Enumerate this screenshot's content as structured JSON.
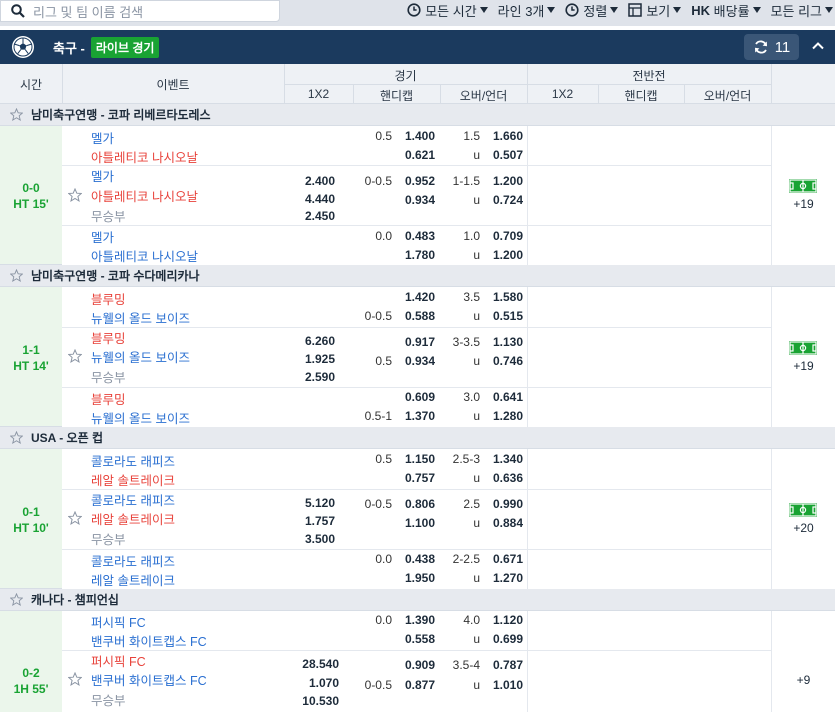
{
  "toolbar": {
    "search_placeholder": "리그 및 팀 이름 검색",
    "time_filter": "모든 시간",
    "lines": "라인 3개",
    "sort": "정렬",
    "view": "보기",
    "odds_type_bold": "HK",
    "odds_type": "배당률",
    "league_filter": "모든 리그"
  },
  "sport": {
    "name": "축구 -",
    "live_label": "라이브 경기",
    "refresh_count": "11"
  },
  "columns": {
    "time": "시간",
    "event": "이벤트",
    "fulltime_group": "경기",
    "halftime_group": "전반전",
    "ft_1x2": "1X2",
    "ft_hdp": "핸디캡",
    "ft_ou": "오버/언더",
    "ht_1x2": "1X2",
    "ht_hdp": "핸디캡",
    "ht_ou": "오버/언더"
  },
  "leagues": [
    {
      "name": "남미축구연맹 - 코파 리베르타도레스"
    },
    {
      "name": "남미축구연맹 - 코파 수다메리카나"
    },
    {
      "name": "USA - 오픈 컵"
    },
    {
      "name": "캐나다 - 챔피언십"
    }
  ],
  "matches": [
    {
      "score": "0-0",
      "time": "HT 15'",
      "more": "+19",
      "draw": "무승부",
      "lines": [
        {
          "home": "멜가",
          "away": "아틀레티코 나시오날",
          "hdp_line": "0.5",
          "hdp_home": "1.400",
          "hdp_away": "0.621",
          "ou_line": "1.5",
          "ou_over": "1.660",
          "ou_u": "u",
          "ou_under": "0.507"
        },
        {
          "home": "멜가",
          "away": "아틀레티코 나시오날",
          "x1": "2.400",
          "x2": "4.440",
          "xd": "2.450",
          "hdp_line": "0-0.5",
          "hdp_home": "0.952",
          "hdp_away": "0.934",
          "ou_line": "1-1.5",
          "ou_over": "1.200",
          "ou_u": "u",
          "ou_under": "0.724"
        },
        {
          "home": "멜가",
          "away": "아틀레티코 나시오날",
          "hdp_line": "0.0",
          "hdp_home": "0.483",
          "hdp_away": "1.780",
          "ou_line": "1.0",
          "ou_over": "0.709",
          "ou_u": "u",
          "ou_under": "1.200"
        }
      ]
    },
    {
      "score": "1-1",
      "time": "HT 14'",
      "more": "+19",
      "draw": "무승부",
      "lines": [
        {
          "home": "블루밍",
          "away": "뉴웰의 올드 보이즈",
          "hdp_line_away": "0-0.5",
          "hdp_home": "1.420",
          "hdp_away": "0.588",
          "ou_line": "3.5",
          "ou_over": "1.580",
          "ou_u": "u",
          "ou_under": "0.515"
        },
        {
          "home": "블루밍",
          "away": "뉴웰의 올드 보이즈",
          "x1": "6.260",
          "x2": "1.925",
          "xd": "2.590",
          "hdp_line_away": "0.5",
          "hdp_home": "0.917",
          "hdp_away": "0.934",
          "ou_line": "3-3.5",
          "ou_over": "1.130",
          "ou_u": "u",
          "ou_under": "0.746"
        },
        {
          "home": "블루밍",
          "away": "뉴웰의 올드 보이즈",
          "hdp_line_away": "0.5-1",
          "hdp_home": "0.609",
          "hdp_away": "1.370",
          "ou_line": "3.0",
          "ou_over": "0.641",
          "ou_u": "u",
          "ou_under": "1.280"
        }
      ]
    },
    {
      "score": "0-1",
      "time": "HT 10'",
      "more": "+20",
      "draw": "무승부",
      "lines": [
        {
          "home": "콜로라도 래피즈",
          "away": "레알 솔트레이크",
          "hdp_line": "0.5",
          "hdp_home": "1.150",
          "hdp_away": "0.757",
          "ou_line": "2.5-3",
          "ou_over": "1.340",
          "ou_u": "u",
          "ou_under": "0.636"
        },
        {
          "home": "콜로라도 래피즈",
          "away": "레알 솔트레이크",
          "x1": "5.120",
          "x2": "1.757",
          "xd": "3.500",
          "hdp_line": "0-0.5",
          "hdp_home": "0.806",
          "hdp_away": "1.100",
          "ou_line": "2.5",
          "ou_over": "0.990",
          "ou_u": "u",
          "ou_under": "0.884"
        },
        {
          "home": "콜로라도 래피즈",
          "away": "레알 솔트레이크",
          "hdp_line": "0.0",
          "hdp_home": "0.438",
          "hdp_away": "1.950",
          "ou_line": "2-2.5",
          "ou_over": "0.671",
          "ou_u": "u",
          "ou_under": "1.270"
        }
      ]
    },
    {
      "score": "0-2",
      "time": "1H 55'",
      "more": "+9",
      "draw": "무승부",
      "lines": [
        {
          "home": "퍼시픽 FC",
          "away": "밴쿠버 화이트캡스 FC",
          "hdp_line": "0.0",
          "hdp_home": "1.390",
          "hdp_away": "0.558",
          "ou_line": "4.0",
          "ou_over": "1.120",
          "ou_u": "u",
          "ou_under": "0.699"
        },
        {
          "home": "퍼시픽 FC",
          "away": "밴쿠버 화이트캡스 FC",
          "x1": "28.540",
          "x2": "1.070",
          "xd": "10.530",
          "hdp_line_away": "0-0.5",
          "hdp_home": "0.909",
          "hdp_away": "0.877",
          "ou_line": "3.5-4",
          "ou_over": "0.787",
          "ou_u": "u",
          "ou_under": "1.010"
        }
      ]
    }
  ],
  "colors": {
    "navy": "#1b3a5e",
    "green": "#19a333",
    "live_row": "#ebf6eb",
    "home_blue": "#2a6fd1",
    "team_red": "#e8433b"
  },
  "icons": [
    "search-icon",
    "clock-icon",
    "chevron-down-icon",
    "table-icon",
    "soccer-ball-icon",
    "refresh-icon",
    "chevron-up-icon",
    "star-icon",
    "pitch-icon"
  ]
}
